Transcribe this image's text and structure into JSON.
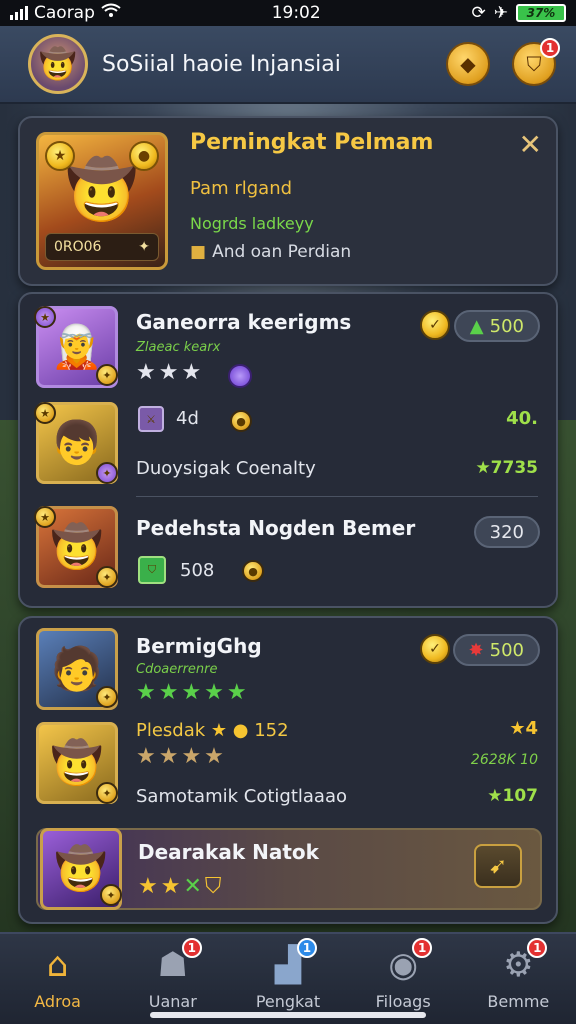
{
  "status_bar": {
    "carrier": "Caorap",
    "time": "19:02",
    "battery": "37%"
  },
  "header": {
    "title": "SoSiial haoie Injansiai",
    "notif_badge": "1"
  },
  "feature": {
    "title": "Perningkat Pelmam",
    "subtitle": "Pam rlgand",
    "green_text": "Nogrds ladkeyy",
    "detail": "And oan Perdian",
    "card_score": "0RO06"
  },
  "list1": [
    {
      "name": "Ganeorra keerigms",
      "subname": "Zlaeac kearx",
      "pill": "500",
      "stars": "★★★"
    },
    {
      "count": "4d",
      "right_value": "40.",
      "line": "Duoysigak Coenalty",
      "right_line": "★7735"
    },
    {
      "name": "Pedehsta Nogden Bemer",
      "pill": "320",
      "count": "508"
    }
  ],
  "list2": [
    {
      "name": "BermigGhg",
      "subname": "Cdoaerrenre",
      "pill": "500",
      "stars": "★★★★★"
    },
    {
      "name_line": "Plesdak",
      "count": "152",
      "right_value": "★4",
      "stars": "★★★★",
      "right_sub": "2628K 10",
      "line": "Samotamik Cotigtlaaao",
      "right_line": "★107"
    },
    {
      "name": "Dearakak Natok",
      "stars": "★★"
    }
  ],
  "nav": [
    {
      "label": "Adroa",
      "icon": "home-icon"
    },
    {
      "label": "Uanar",
      "icon": "users-icon",
      "badge": "1"
    },
    {
      "label": "Pengkat",
      "icon": "ranking-icon",
      "badge": "1"
    },
    {
      "label": "Filoags",
      "icon": "chat-icon",
      "badge": "1"
    },
    {
      "label": "Bemme",
      "icon": "gear-icon",
      "badge": "1"
    }
  ]
}
